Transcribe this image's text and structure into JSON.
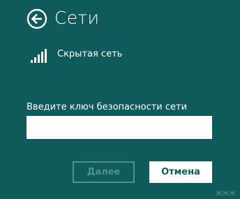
{
  "header": {
    "back_icon": "back-arrow-circle-icon",
    "title": "Сети"
  },
  "network": {
    "icon": "wifi-signal-icon",
    "signal_bars": 5,
    "name": "Скрытая сеть"
  },
  "security_key": {
    "label": "Введите ключ безопасности сети",
    "value": "",
    "placeholder": ""
  },
  "buttons": {
    "next_label": "Далее",
    "cancel_label": "Отмена"
  },
  "watermark": "ЖЖЖ",
  "colors": {
    "background": "#0f5a5a",
    "foreground": "#ffffff",
    "disabled": "#4f9090"
  }
}
